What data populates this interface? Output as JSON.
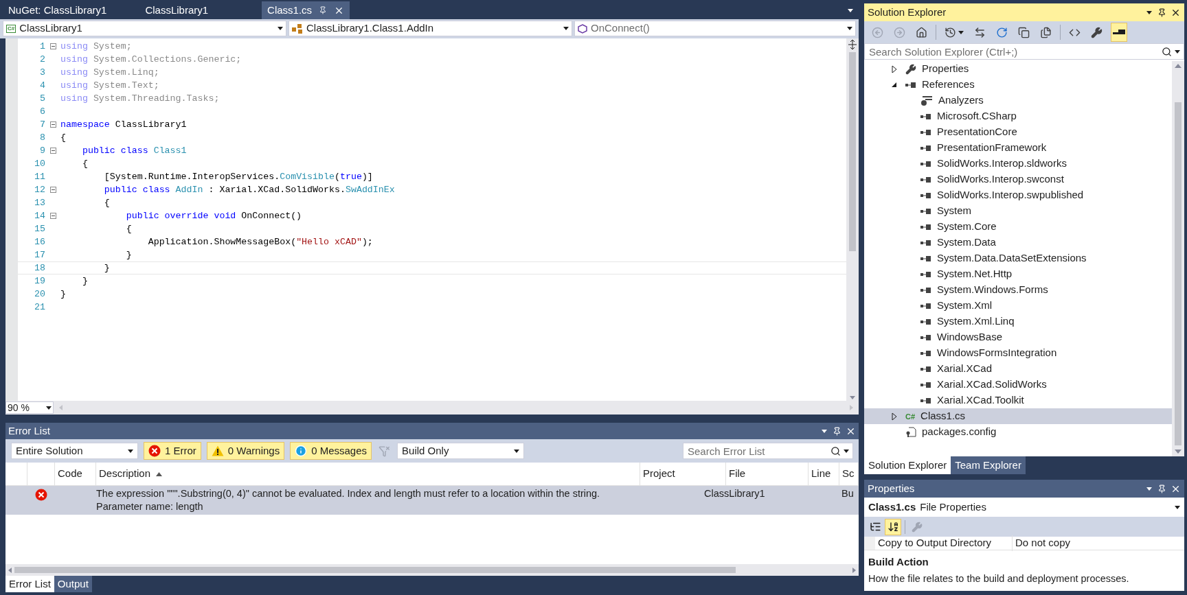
{
  "editor_tabs": [
    {
      "label": "NuGet: ClassLibrary1",
      "selected": false
    },
    {
      "label": "ClassLibrary1",
      "selected": false
    },
    {
      "label": "Class1.cs",
      "selected": true
    }
  ],
  "nav_bar": {
    "project_icon": "C#",
    "project": "ClassLibrary1",
    "type": "ClassLibrary1.Class1.AddIn",
    "member": "OnConnect()"
  },
  "code_lines": [
    {
      "number": "1",
      "foldable": true,
      "current": false,
      "tokens": [
        {
          "kind": "unused_keyword",
          "text": "using"
        },
        {
          "kind": "unused",
          "text": " System;"
        }
      ]
    },
    {
      "number": "2",
      "foldable": false,
      "current": false,
      "tokens": [
        {
          "kind": "unused_keyword",
          "text": "using"
        },
        {
          "kind": "unused",
          "text": " System.Collections.Generic;"
        }
      ]
    },
    {
      "number": "3",
      "foldable": false,
      "current": false,
      "tokens": [
        {
          "kind": "unused_keyword",
          "text": "using"
        },
        {
          "kind": "unused",
          "text": " System.Linq;"
        }
      ]
    },
    {
      "number": "4",
      "foldable": false,
      "current": false,
      "tokens": [
        {
          "kind": "unused_keyword",
          "text": "using"
        },
        {
          "kind": "unused",
          "text": " System.Text;"
        }
      ]
    },
    {
      "number": "5",
      "foldable": false,
      "current": false,
      "tokens": [
        {
          "kind": "unused_keyword",
          "text": "using"
        },
        {
          "kind": "unused",
          "text": " System.Threading.Tasks;"
        }
      ]
    },
    {
      "number": "6",
      "foldable": false,
      "current": false
    },
    {
      "number": "7",
      "foldable": true,
      "current": false,
      "tokens": [
        {
          "kind": "keyword",
          "text": "namespace"
        },
        {
          "kind": "plain",
          "text": " ClassLibrary1"
        }
      ]
    },
    {
      "number": "8",
      "foldable": false,
      "current": false,
      "tokens": [
        {
          "kind": "plain",
          "text": "{"
        }
      ]
    },
    {
      "number": "9",
      "foldable": true,
      "current": false,
      "tokens": [
        {
          "kind": "keyword",
          "text": "    public class"
        },
        {
          "kind": "type",
          "text": " Class1"
        }
      ]
    },
    {
      "number": "10",
      "foldable": false,
      "current": false,
      "tokens": [
        {
          "kind": "plain",
          "text": "    {"
        }
      ]
    },
    {
      "number": "11",
      "foldable": false,
      "current": false,
      "tokens": [
        {
          "kind": "plain",
          "text": "        [System.Runtime.InteropServices."
        },
        {
          "kind": "type",
          "text": "ComVisible"
        },
        {
          "kind": "plain",
          "text": "("
        },
        {
          "kind": "keyword",
          "text": "true"
        },
        {
          "kind": "plain",
          "text": ")]"
        }
      ]
    },
    {
      "number": "12",
      "foldable": true,
      "current": false,
      "tokens": [
        {
          "kind": "keyword",
          "text": "        public class"
        },
        {
          "kind": "type",
          "text": " AddIn"
        },
        {
          "kind": "plain",
          "text": " : Xarial.XCad.SolidWorks."
        },
        {
          "kind": "type",
          "text": "SwAddInEx"
        }
      ]
    },
    {
      "number": "13",
      "foldable": false,
      "current": false,
      "tokens": [
        {
          "kind": "plain",
          "text": "        {"
        }
      ]
    },
    {
      "number": "14",
      "foldable": true,
      "current": false,
      "tokens": [
        {
          "kind": "keyword",
          "text": "            public override void"
        },
        {
          "kind": "plain",
          "text": " OnConnect()"
        }
      ]
    },
    {
      "number": "15",
      "foldable": false,
      "current": false,
      "tokens": [
        {
          "kind": "plain",
          "text": "            {"
        }
      ]
    },
    {
      "number": "16",
      "foldable": false,
      "current": false,
      "tokens": [
        {
          "kind": "plain",
          "text": "                Application.ShowMessageBox("
        },
        {
          "kind": "string",
          "text": "\"Hello xCAD\""
        },
        {
          "kind": "plain",
          "text": ");"
        }
      ]
    },
    {
      "number": "17",
      "foldable": false,
      "current": false,
      "tokens": [
        {
          "kind": "plain",
          "text": "            }"
        }
      ]
    },
    {
      "number": "18",
      "foldable": false,
      "current": true,
      "tokens": [
        {
          "kind": "plain",
          "text": "        }"
        }
      ]
    },
    {
      "number": "19",
      "foldable": false,
      "current": false,
      "tokens": [
        {
          "kind": "plain",
          "text": "    }"
        }
      ]
    },
    {
      "number": "20",
      "foldable": false,
      "current": false,
      "tokens": [
        {
          "kind": "plain",
          "text": "}"
        }
      ]
    },
    {
      "number": "21",
      "foldable": false,
      "current": false
    }
  ],
  "zoom": "90 %",
  "error_list": {
    "title": "Error List",
    "scope": "Entire Solution",
    "filters": [
      {
        "kind": "error",
        "label": "1 Error",
        "selected": true
      },
      {
        "kind": "warning",
        "label": "0 Warnings",
        "selected": true
      },
      {
        "kind": "message",
        "label": "0 Messages",
        "selected": true
      }
    ],
    "build_filter": "Build Only",
    "search": {
      "placeholder": "Search Error List"
    },
    "columns": [
      "Code",
      "Description",
      "Project",
      "File",
      "Line",
      "Sc"
    ],
    "rows": [
      {
        "kind": "error",
        "description": "The expression \"\"\".Substring(0, 4)\" cannot be evaluated. Index and length must refer to a location within the string.\nParameter name: length",
        "project": "ClassLibrary1",
        "column_6": "Bu"
      }
    ]
  },
  "bottom_tabs": [
    {
      "label": "Error List",
      "selected": true
    },
    {
      "label": "Output",
      "selected": false
    }
  ],
  "solution_explorer": {
    "title": "Solution Explorer",
    "toolbar": [
      {
        "kind": "back",
        "disabled": true
      },
      {
        "kind": "forward",
        "disabled": true
      },
      {
        "kind": "home",
        "disabled": false
      },
      {
        "kind": "history",
        "disabled": false
      },
      {
        "kind": "sync",
        "disabled": false
      },
      {
        "kind": "refresh",
        "disabled": false
      },
      {
        "kind": "collapse",
        "disabled": false
      },
      {
        "kind": "show_all",
        "disabled": false
      },
      {
        "kind": "code",
        "disabled": false
      },
      {
        "kind": "properties",
        "disabled": false
      },
      {
        "kind": "preview",
        "disabled": false,
        "selected": true
      }
    ],
    "search": {
      "placeholder": "Search Solution Explorer (Ctrl+;)"
    },
    "tree": [
      {
        "label": "Properties",
        "kind": "properties",
        "expanded": false,
        "selected": false
      },
      {
        "label": "References",
        "kind": "references",
        "expanded": true,
        "selected": false,
        "children": [
          {
            "label": "Analyzers",
            "kind": "analyzers",
            "selected": false
          },
          {
            "label": "Microsoft.CSharp",
            "kind": "reference",
            "selected": false
          },
          {
            "label": "PresentationCore",
            "kind": "reference",
            "selected": false
          },
          {
            "label": "PresentationFramework",
            "kind": "reference",
            "selected": false
          },
          {
            "label": "SolidWorks.Interop.sldworks",
            "kind": "reference",
            "selected": false
          },
          {
            "label": "SolidWorks.Interop.swconst",
            "kind": "reference",
            "selected": false
          },
          {
            "label": "SolidWorks.Interop.swpublished",
            "kind": "reference",
            "selected": false
          },
          {
            "label": "System",
            "kind": "reference",
            "selected": false
          },
          {
            "label": "System.Core",
            "kind": "reference",
            "selected": false
          },
          {
            "label": "System.Data",
            "kind": "reference",
            "selected": false
          },
          {
            "label": "System.Data.DataSetExtensions",
            "kind": "reference",
            "selected": false
          },
          {
            "label": "System.Net.Http",
            "kind": "reference",
            "selected": false
          },
          {
            "label": "System.Windows.Forms",
            "kind": "reference",
            "selected": false
          },
          {
            "label": "System.Xml",
            "kind": "reference",
            "selected": false
          },
          {
            "label": "System.Xml.Linq",
            "kind": "reference",
            "selected": false
          },
          {
            "label": "WindowsBase",
            "kind": "reference",
            "selected": false
          },
          {
            "label": "WindowsFormsIntegration",
            "kind": "reference",
            "selected": false
          },
          {
            "label": "Xarial.XCad",
            "kind": "reference",
            "selected": false
          },
          {
            "label": "Xarial.XCad.SolidWorks",
            "kind": "reference",
            "selected": false
          },
          {
            "label": "Xarial.XCad.Toolkit",
            "kind": "reference",
            "selected": false
          }
        ]
      },
      {
        "label": "Class1.cs",
        "kind": "csharp",
        "icon_text": "C#",
        "expanded": false,
        "selected": true
      },
      {
        "label": "packages.config",
        "kind": "config",
        "selected": false
      }
    ],
    "tabs": [
      {
        "label": "Solution Explorer",
        "selected": true
      },
      {
        "label": "Team Explorer",
        "selected": false
      }
    ]
  },
  "properties": {
    "title": "Properties",
    "object_name": "Class1.cs",
    "object_type": "File Properties",
    "toolbar": [
      {
        "kind": "categorized",
        "selected": false,
        "disabled": false
      },
      {
        "kind": "alphabetical",
        "selected": true,
        "disabled": false
      },
      {
        "kind": "property_pages",
        "selected": false,
        "disabled": true
      }
    ],
    "rows": [
      {
        "name": "Copy to Output Directory",
        "value": "Do not copy"
      }
    ],
    "description_title": "Build Action",
    "description": "How the file relates to the build and deployment processes."
  }
}
